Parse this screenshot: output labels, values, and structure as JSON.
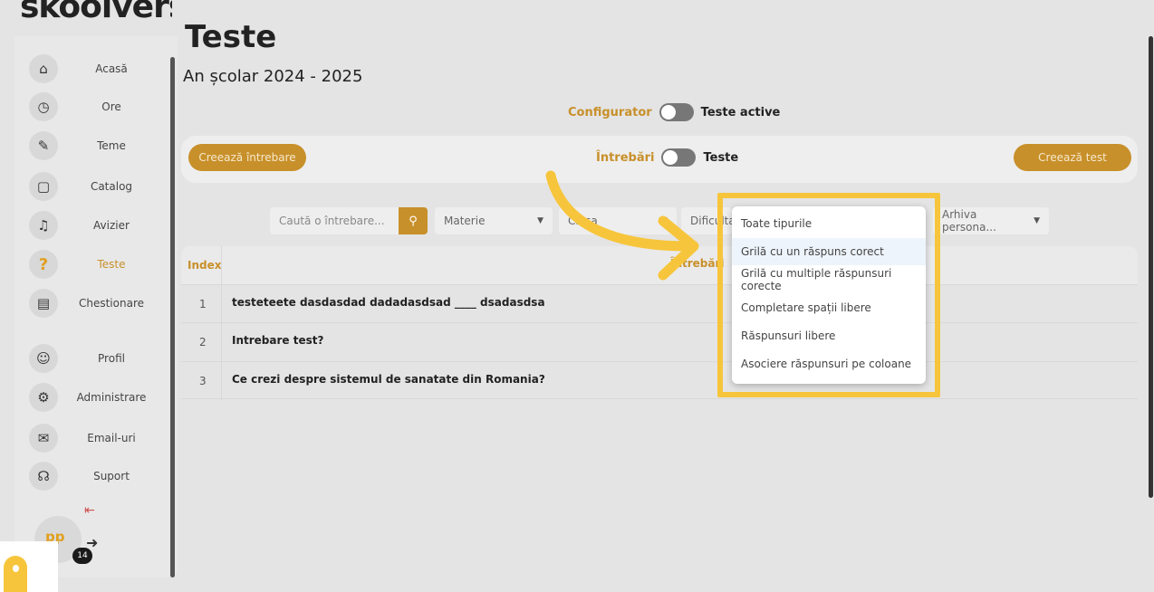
{
  "app": {
    "logo_text": "skoolvers"
  },
  "sidebar": {
    "items": [
      {
        "label": "Acasă",
        "icon": "home-icon"
      },
      {
        "label": "Ore",
        "icon": "clock-icon"
      },
      {
        "label": "Teme",
        "icon": "pencil-icon"
      },
      {
        "label": "Catalog",
        "icon": "book-icon"
      },
      {
        "label": "Avizier",
        "icon": "bell-icon"
      },
      {
        "label": "Teste",
        "icon": "question-icon",
        "active": true
      },
      {
        "label": "Chestionare",
        "icon": "document-icon"
      },
      {
        "label": "Profil",
        "icon": "profile-icon"
      },
      {
        "label": "Administrare",
        "icon": "gears-icon"
      },
      {
        "label": "Email-uri",
        "icon": "mail-icon"
      },
      {
        "label": "Suport",
        "icon": "headset-icon"
      }
    ],
    "avatar_initials": "pp",
    "notification_count": "14"
  },
  "header": {
    "title": "Teste",
    "subtitle": "An școlar 2024 - 2025"
  },
  "mode_toggle": {
    "left_label": "Configurator",
    "right_label": "Teste active"
  },
  "panel": {
    "create_question": "Creează întrebare",
    "toggle_left": "Întrebări",
    "toggle_right": "Teste",
    "create_test": "Creează test"
  },
  "filters": {
    "search_placeholder": "Caută o întrebare...",
    "subject": "Materie",
    "class": "Clasa",
    "difficulty": "Dificultate",
    "archive": "Arhiva persona..."
  },
  "table": {
    "headers": {
      "index": "Index",
      "question": "Întrebări"
    },
    "rows": [
      {
        "index": "1",
        "text": "testeteete dasdasdad dadadasdsad ____ dsadasdsa"
      },
      {
        "index": "2",
        "text": "Intrebare test?"
      },
      {
        "index": "3",
        "text": "Ce crezi despre sistemul de sanatate din Romania?"
      }
    ]
  },
  "type_dropdown": {
    "options": [
      "Toate tipurile",
      "Grilă cu un răspuns corect",
      "Grilă cu multiple răspunsuri corecte",
      "Completare spații libere",
      "Răspunsuri libere",
      "Asociere răspunsuri pe coloane"
    ],
    "hovered_index": 1
  },
  "colors": {
    "accent": "#c8902a",
    "highlight": "#f7c53b"
  }
}
